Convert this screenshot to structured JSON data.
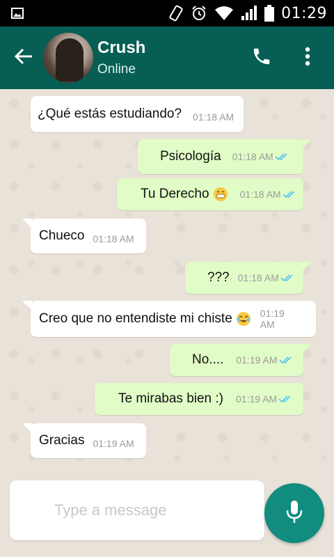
{
  "status_bar": {
    "time": "01:29",
    "icons": [
      "image-icon",
      "rotate-icon",
      "alarm-icon",
      "wifi-icon",
      "signal-icon",
      "battery-icon"
    ]
  },
  "header": {
    "contact_name": "Crush",
    "status": "Online",
    "icons": [
      "back-arrow-icon",
      "phone-icon",
      "more-vert-icon"
    ]
  },
  "messages": [
    {
      "direction": "in",
      "text": "¿Qué estás estudiando?",
      "time": "01:18 AM"
    },
    {
      "direction": "out",
      "text": "Psicología",
      "time": "01:18 AM",
      "read": true
    },
    {
      "direction": "out",
      "text": "Tu Derecho",
      "emoji": "grinning-face-emoji",
      "time": "01:18 AM",
      "read": true
    },
    {
      "direction": "in",
      "text": "Chueco",
      "time": "01:18 AM"
    },
    {
      "direction": "out",
      "text": "???",
      "time": "01:18 AM",
      "read": true
    },
    {
      "direction": "in",
      "text": "Creo que no entendiste mi chiste",
      "emoji": "tears-of-joy-emoji",
      "time_line1": "01:19",
      "time_line2": "AM"
    },
    {
      "direction": "out",
      "text": "No....",
      "time": "01:19 AM",
      "read": true
    },
    {
      "direction": "out",
      "text": "Te mirabas bien :)",
      "time": "01:19 AM",
      "read": true
    },
    {
      "direction": "in",
      "text": "Gracias",
      "time": "01:19 AM"
    }
  ],
  "composer": {
    "placeholder": "Type a message",
    "mic_icon": "microphone-icon"
  },
  "colors": {
    "header": "#075e54",
    "outgoing_bubble": "#e1fcc6",
    "incoming_bubble": "#ffffff",
    "read_ticks": "#4fc3f7",
    "mic_button": "#128c7e"
  }
}
